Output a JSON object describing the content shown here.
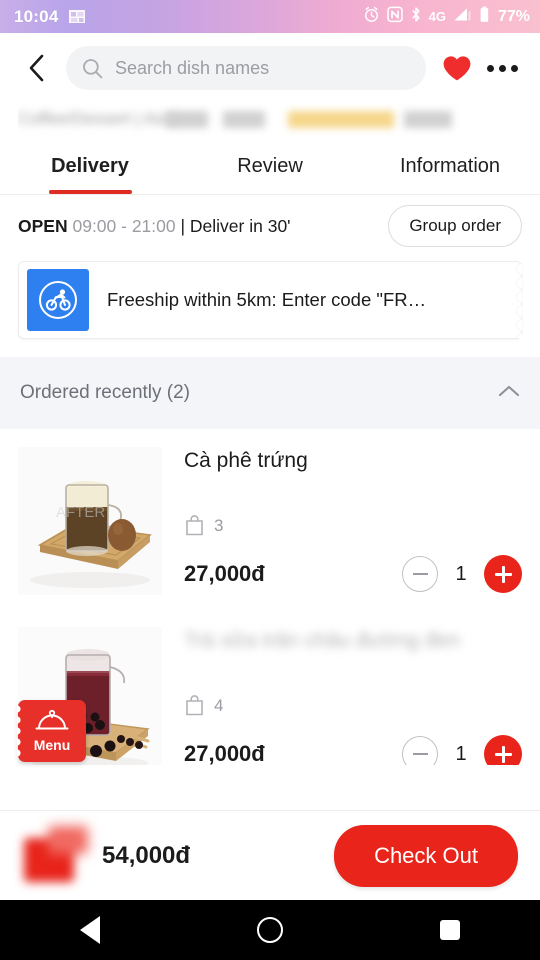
{
  "statusbar": {
    "time": "10:04",
    "network": "4G",
    "battery": "77%",
    "icons": [
      "gallery-icon",
      "alarm-icon",
      "nfc-icon",
      "bluetooth-icon",
      "signal-icon",
      "battery-icon"
    ]
  },
  "header": {
    "back_icon": "chevron-left-icon",
    "search_placeholder": "Search dish names",
    "search_value": "",
    "favorite_icon": "heart-icon",
    "more_icon": "more-options-icon"
  },
  "restaurant_meta": {
    "blurred_text": "Coffee/Dessert | Asia",
    "note": "obscured"
  },
  "tabs": [
    {
      "label": "Delivery",
      "active": true
    },
    {
      "label": "Review",
      "active": false
    },
    {
      "label": "Information",
      "active": false
    }
  ],
  "status_row": {
    "open_label": "OPEN",
    "hours": "09:00 - 21:00",
    "delivery_time": "| Deliver in 30'",
    "group_order_label": "Group order"
  },
  "voucher": {
    "icon": "bike-delivery-icon",
    "icon_bg": "#2e7ff0",
    "text": "Freeship within 5km: Enter code \"FR…"
  },
  "section": {
    "title": "Ordered recently (2)",
    "collapse_icon": "chevron-up-icon"
  },
  "dishes": [
    {
      "name": "Cà phê trứng",
      "name_blurred": false,
      "order_count": "3",
      "price": "27,000đ",
      "quantity": "1",
      "photo": "egg-coffee-photo"
    },
    {
      "name": "Trà sữa trân châu đường đen",
      "name_blurred": true,
      "order_count": "4",
      "price": "27,000đ",
      "quantity": "1",
      "photo": "bubble-tea-photo"
    }
  ],
  "menu_fab": {
    "label": "Menu",
    "icon": "cloche-bell-icon"
  },
  "bottom_bar": {
    "cart_icon": "cart-icon",
    "total": "54,000đ",
    "checkout_label": "Check Out"
  },
  "navbar": {
    "back": "android-back-icon",
    "home": "android-home-icon",
    "recents": "android-recents-icon"
  },
  "colors": {
    "accent_red": "#e8241b",
    "voucher_blue": "#2e7ff0",
    "section_bg": "#f4f5f9"
  }
}
